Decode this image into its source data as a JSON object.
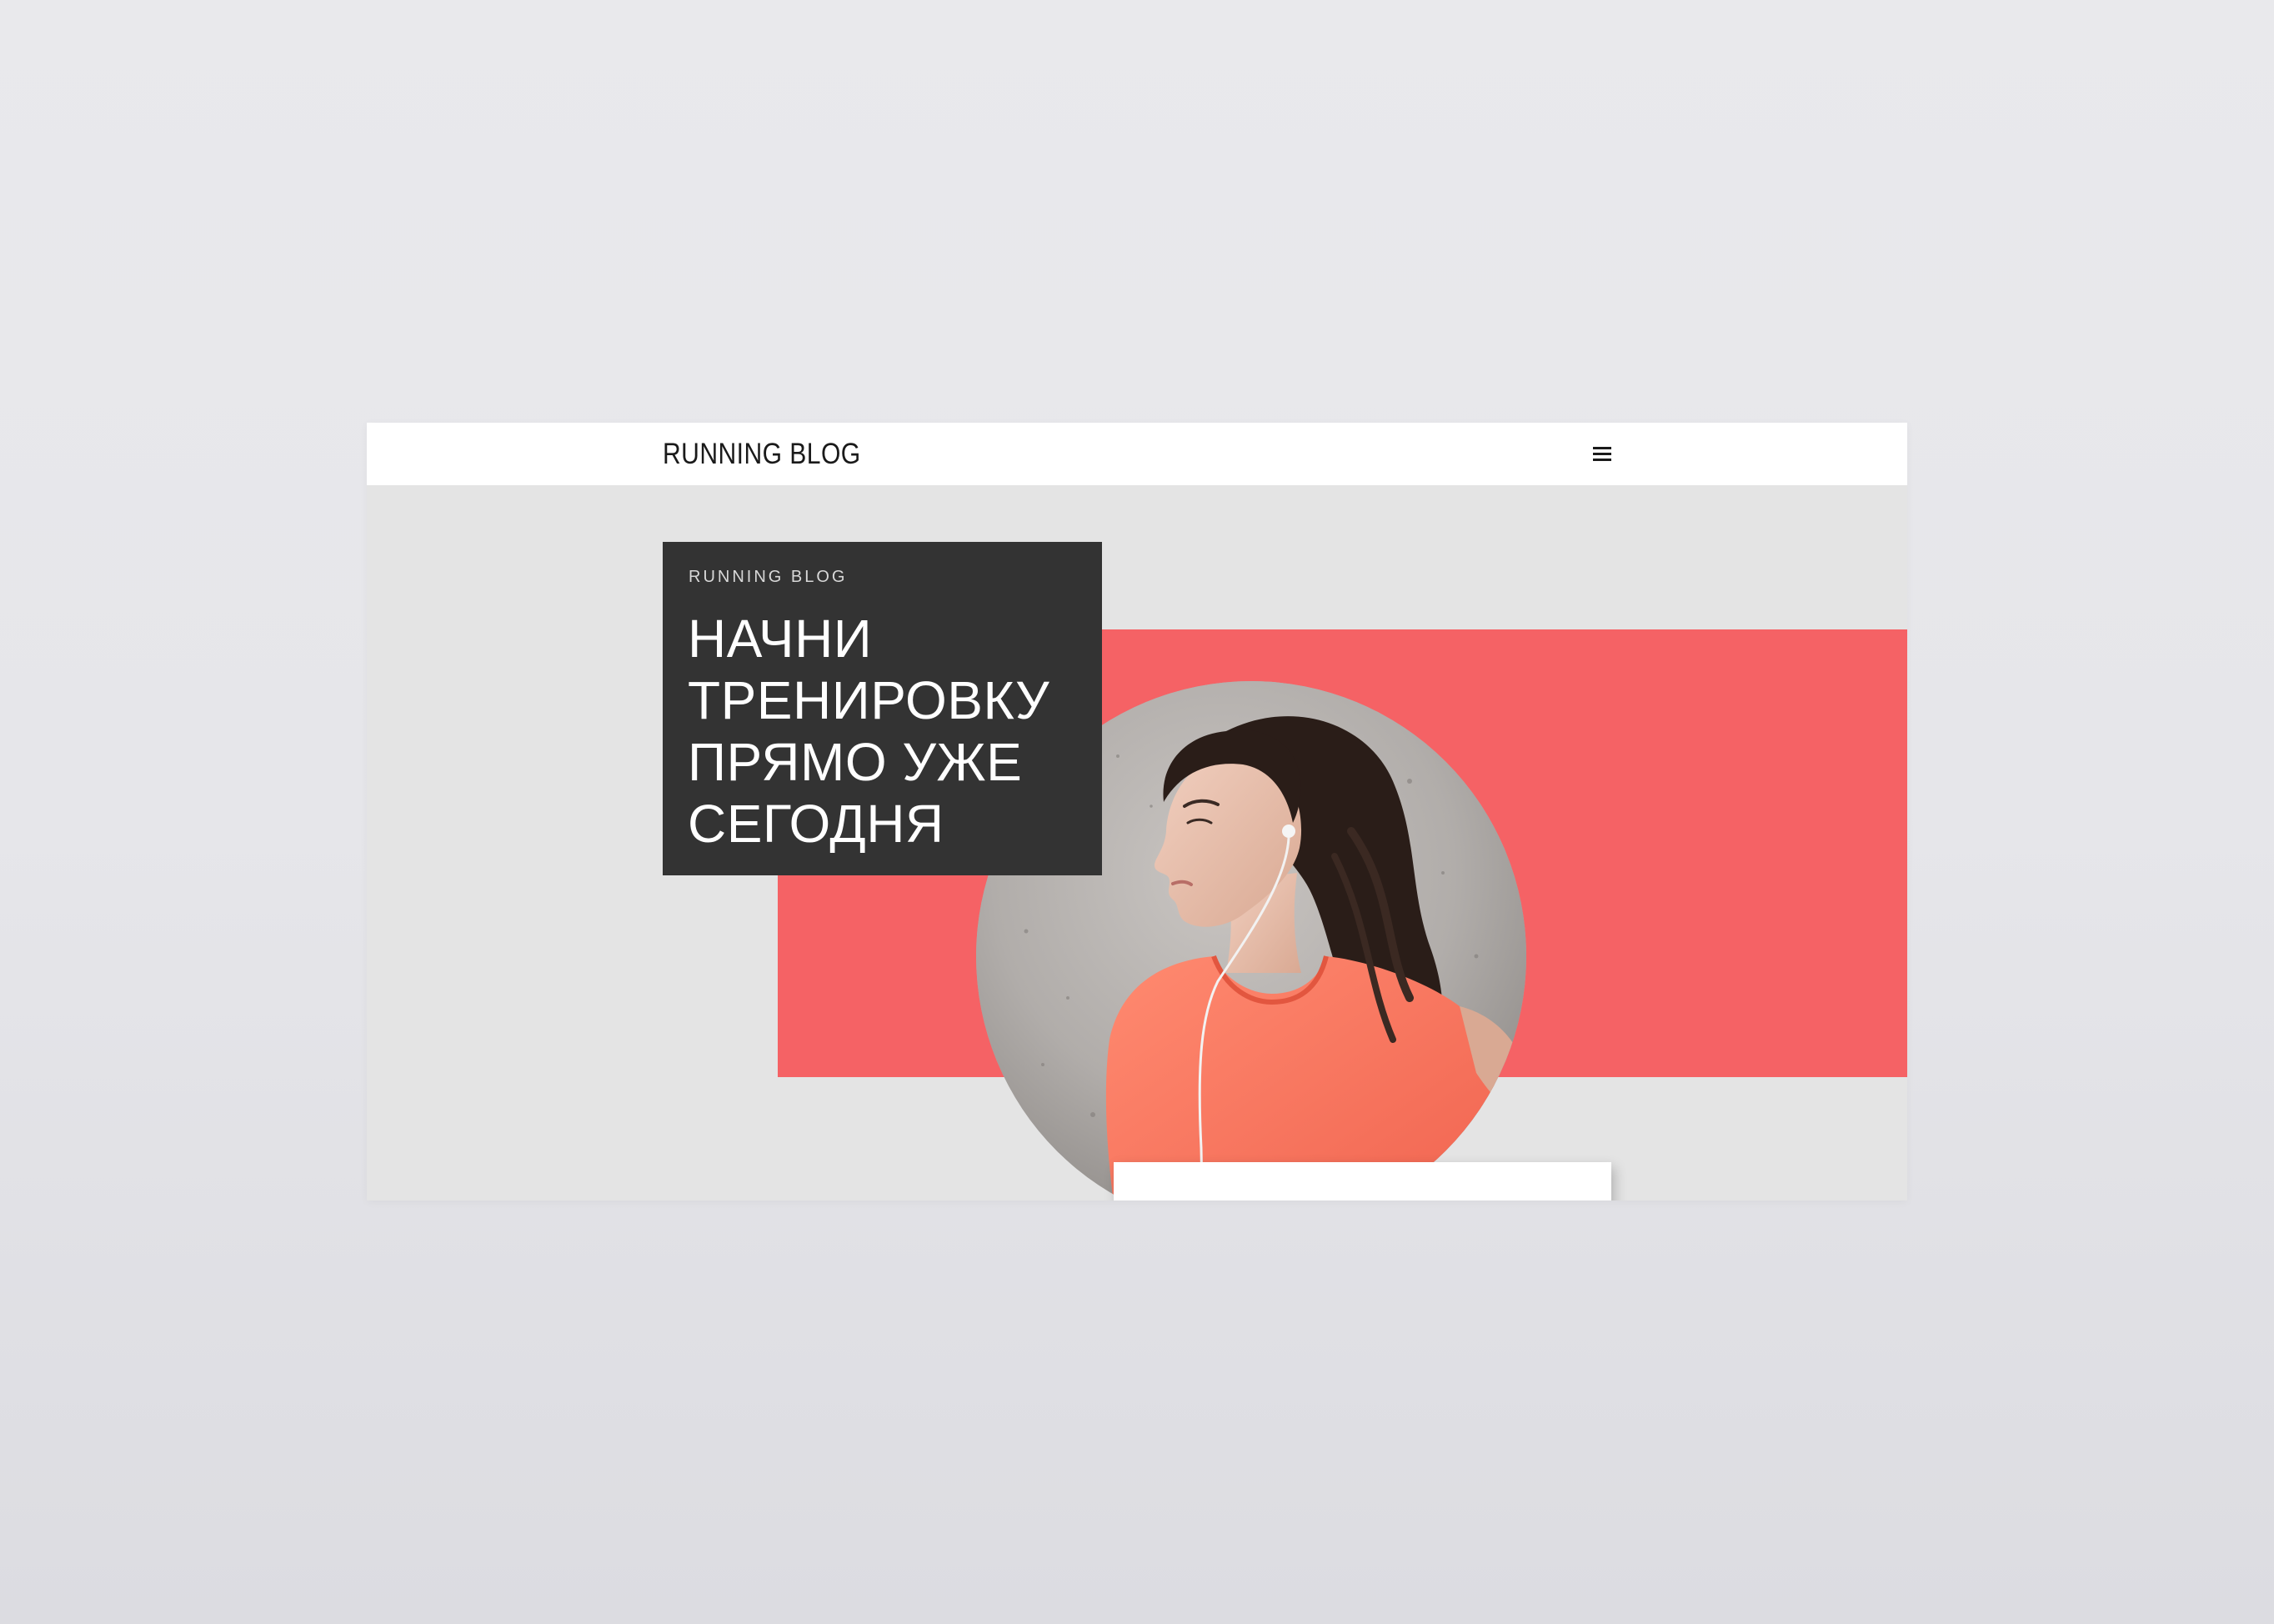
{
  "header": {
    "brand": "RUNNING BLOG",
    "menu_icon": "hamburger-menu-icon"
  },
  "hero": {
    "kicker": "RUNNING BLOG",
    "title": "НАЧНИ ТРЕНИРОВКУ ПРЯМО УЖЕ СЕГОДНЯ",
    "image": "woman-runner-photo"
  },
  "colors": {
    "accent": "#f56265",
    "dark_card": "#333333",
    "hero_background": "#e4e4e4",
    "page_background": "#e7e7ea",
    "shirt": "#f8735e"
  }
}
